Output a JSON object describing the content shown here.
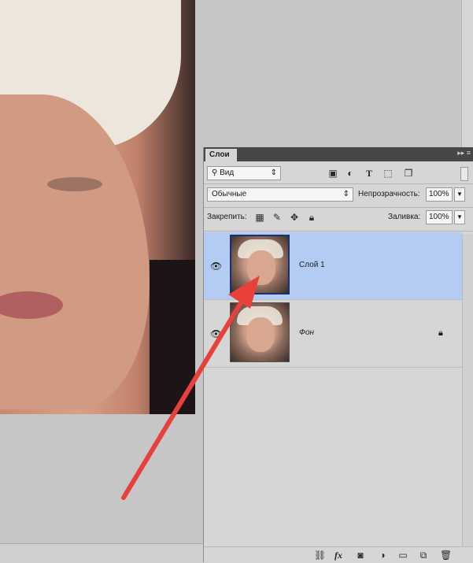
{
  "panel": {
    "tab_label": "Слои",
    "tab_menu_glyph": "▸▸ ≡",
    "filter": {
      "label": "Вид",
      "search_glyph": "⚲",
      "arrow": "⇕"
    },
    "blend_mode": {
      "value": "Обычные",
      "arrow": "⇕"
    },
    "opacity": {
      "label": "Непрозрачность:",
      "value": "100%"
    },
    "lock": {
      "label": "Закрепить:"
    },
    "fill": {
      "label": "Заливка:",
      "value": "100%"
    },
    "layers": [
      {
        "name": "Слой 1",
        "selected": true
      },
      {
        "name": "Фон",
        "selected": false,
        "locked": true
      }
    ]
  },
  "icons": {
    "filter_types": [
      "image-filter-icon",
      "adjustment-filter-icon",
      "type-filter-icon",
      "shape-filter-icon",
      "smart-object-filter-icon"
    ],
    "lock_types": [
      "lock-transparent-icon",
      "lock-image-icon",
      "lock-position-icon",
      "lock-all-icon"
    ],
    "footer": [
      "link-layers-icon",
      "fx-icon",
      "mask-icon",
      "adjustment-layer-icon",
      "group-icon",
      "new-layer-icon",
      "delete-icon"
    ]
  },
  "footer": {
    "fx_label": "fx"
  },
  "colors": {
    "selection": "#b4cbf4",
    "arrow": "#e8403a",
    "tabbar": "#474747"
  }
}
